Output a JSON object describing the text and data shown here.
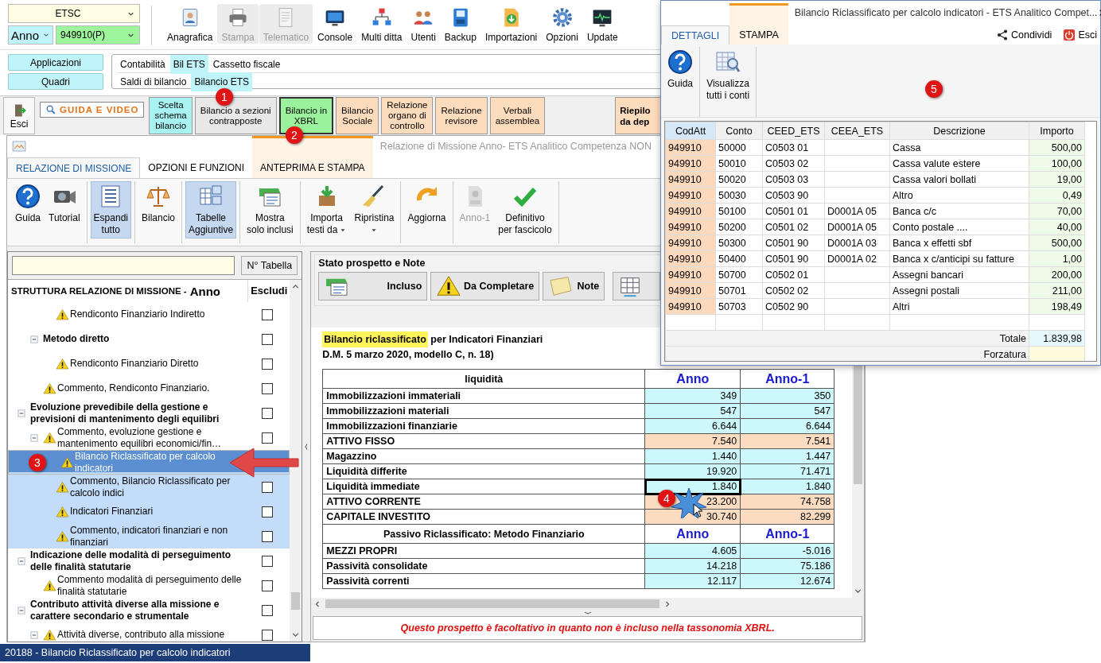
{
  "top_bar": {
    "company": {
      "value": "ETSC"
    },
    "year": {
      "value": "Anno"
    },
    "code": {
      "value": "949910(P)"
    },
    "buttons": [
      {
        "label": "Anagrafica",
        "disabled": false
      },
      {
        "label": "Stampa",
        "disabled": true
      },
      {
        "label": "Telematico",
        "disabled": true
      },
      {
        "label": "Console",
        "disabled": false
      },
      {
        "label": "Multi ditta",
        "disabled": false
      },
      {
        "label": "Utenti",
        "disabled": false
      },
      {
        "label": "Backup",
        "disabled": false
      },
      {
        "label": "Importazioni",
        "disabled": false
      },
      {
        "label": "Opzioni",
        "disabled": false
      },
      {
        "label": "Update",
        "disabled": false
      }
    ]
  },
  "navigation": {
    "side_buttons": [
      "Applicazioni",
      "Quadri"
    ],
    "rows": [
      {
        "items": [
          {
            "label": "Contabilità",
            "selected": false
          },
          {
            "label": "Bil ETS",
            "selected": true
          },
          {
            "label": "Cassetto fiscale",
            "selected": false
          }
        ]
      },
      {
        "items": [
          {
            "label": "Saldi di bilancio",
            "selected": false
          },
          {
            "label": "Bilancio ETS",
            "selected": true
          }
        ]
      }
    ]
  },
  "module_bar": {
    "exit_label": "Esci",
    "guide_label": "GUIDA E VIDEO",
    "modules": [
      {
        "label": "Scelta\nschema\nbilancio",
        "color": "#a8f2f2",
        "selected": false
      },
      {
        "label": "Bilancio a sezioni\ncontrapposte",
        "color": "#e8e8e8",
        "selected": false
      },
      {
        "label": "Bilancio in\nXBRL",
        "color": "#9cf29c",
        "selected": true
      },
      {
        "label": "Bilancio\nSociale",
        "color": "#fcdcbc",
        "selected": false
      },
      {
        "label": "Relazione\norgano di\ncontrollo",
        "color": "#fcdcbc",
        "selected": false
      },
      {
        "label": "Relazione\nrevisore",
        "color": "#fcdcbc",
        "selected": false
      },
      {
        "label": "Verbali\nassemblea",
        "color": "#fcdcbc",
        "selected": false
      }
    ],
    "summary_button": {
      "label": "Riepilo\nda dep"
    }
  },
  "window": {
    "title": "Relazione di Missione Anno- ETS Analitico Competenza NON",
    "tabs": [
      {
        "label": "RELAZIONE DI MISSIONE",
        "selected": true,
        "contextual": false
      },
      {
        "label": "OPZIONI E FUNZIONI",
        "selected": false,
        "contextual": false
      },
      {
        "label": "ANTEPRIMA E STAMPA",
        "selected": false,
        "contextual": true
      }
    ],
    "ribbon": [
      {
        "buttons": [
          {
            "label": "Guida",
            "on": false,
            "disabled": false,
            "dropdown": false
          },
          {
            "label": "Tutorial",
            "on": false,
            "disabled": false,
            "dropdown": false
          }
        ]
      },
      {
        "buttons": [
          {
            "label": "Espandi\ntutto",
            "on": true,
            "disabled": false,
            "dropdown": false
          }
        ]
      },
      {
        "buttons": [
          {
            "label": "Bilancio",
            "on": false,
            "disabled": false,
            "dropdown": false
          }
        ]
      },
      {
        "buttons": [
          {
            "label": "Tabelle\nAggiuntive",
            "on": true,
            "disabled": false,
            "dropdown": false
          }
        ]
      },
      {
        "buttons": [
          {
            "label": "Mostra\nsolo inclusi",
            "on": false,
            "disabled": false,
            "dropdown": false
          }
        ]
      },
      {
        "buttons": [
          {
            "label": "Importa\ntesti da",
            "on": false,
            "disabled": false,
            "dropdown": true
          },
          {
            "label": "Ripristina",
            "on": false,
            "disabled": false,
            "dropdown": true
          }
        ]
      },
      {
        "buttons": [
          {
            "label": "Aggiorna",
            "on": false,
            "disabled": false,
            "dropdown": false
          }
        ]
      },
      {
        "buttons": [
          {
            "label": "Anno-1",
            "on": false,
            "disabled": true,
            "dropdown": false
          },
          {
            "label": "Definitivo\nper fascicolo",
            "on": false,
            "disabled": false,
            "dropdown": false
          }
        ]
      }
    ]
  },
  "structure_panel": {
    "table_button": "N° Tabella",
    "title": "STRUTTURA RELAZIONE DI MISSIONE -",
    "title_year": "Anno",
    "exclude_header": "Escludi",
    "tree": [
      {
        "children": [
          {
            "children": [
              {
                "label": "Rendiconto Finanziario Indiretto",
                "kind": "comment",
                "excluded": false,
                "selected": false,
                "highlighted": false
              }
            ]
          },
          {
            "label": "Metodo diretto",
            "kind": "section",
            "expanded": true,
            "excluded": false,
            "selected": false,
            "highlighted": false,
            "children": [
              {
                "label": "Rendiconto Finanziario Diretto",
                "kind": "comment",
                "excluded": false,
                "selected": false,
                "highlighted": false
              }
            ]
          },
          {
            "label": "Commento, Rendiconto Finanziario.",
            "kind": "comment",
            "excluded": false,
            "selected": false,
            "highlighted": false
          }
        ]
      },
      {
        "label": "Evoluzione prevedibile della gestione e previsioni di mantenimento degli equilibri",
        "kind": "section",
        "expanded": true,
        "excluded": false,
        "selected": false,
        "highlighted": false,
        "children": [
          {
            "label": "Commento, evoluzione gestione e mantenimento equilibri economici/fin…",
            "kind": "comment",
            "expanded": true,
            "excluded": false,
            "selected": false,
            "highlighted": false,
            "children": [
              {
                "label": "Bilancio Riclassificato per calcolo indicatori",
                "kind": "comment",
                "selected": true,
                "highlighted": true
              },
              {
                "label": "Commento, Bilancio Riclassificato per calcolo indici",
                "kind": "comment",
                "excluded": false,
                "selected": false,
                "highlighted": true
              },
              {
                "label": "Indicatori Finanziari",
                "kind": "comment",
                "excluded": false,
                "selected": false,
                "highlighted": true
              },
              {
                "label": "Commento, indicatori finanziari e non finanziari",
                "kind": "comment",
                "excluded": false,
                "selected": false,
                "highlighted": true
              }
            ]
          }
        ]
      },
      {
        "label": "Indicazione delle modalità di perseguimento delle finalità statutarie",
        "kind": "section",
        "expanded": true,
        "excluded": false,
        "selected": false,
        "highlighted": false,
        "children": [
          {
            "label": "Commento modalità di perseguimento delle finalità statutarie",
            "kind": "comment",
            "excluded": false,
            "selected": false,
            "highlighted": false
          }
        ]
      },
      {
        "label": "Contributo attività diverse alla missione e carattere secondario e strumentale",
        "kind": "section",
        "expanded": true,
        "excluded": false,
        "selected": false,
        "highlighted": false,
        "children": [
          {
            "label": "Attività diverse, contributo alla missione",
            "kind": "comment",
            "expanded": true,
            "excluded": false,
            "selected": false,
            "highlighted": false
          }
        ]
      }
    ]
  },
  "status_panel": {
    "title": "Stato prospetto e Note",
    "buttons": [
      "Incluso",
      "Da Completare",
      "Note"
    ]
  },
  "document": {
    "heading_highlight": "Bilancio riclassificato",
    "heading_rest": "per Indicatori Finanziari",
    "subheading": "D.M. 5 marzo 2020, modello C, n. 18)",
    "rows": [
      {
        "kind": "header",
        "label": "liquidità",
        "values": [
          "Anno",
          "Anno-1"
        ],
        "selected": false
      },
      {
        "kind": "item",
        "label": "Immobilizzazioni immateriali",
        "values": [
          "349",
          "350"
        ],
        "selected": false
      },
      {
        "kind": "item",
        "label": "Immobilizzazioni materiali",
        "values": [
          "547",
          "547"
        ],
        "selected": false
      },
      {
        "kind": "item",
        "label": "Immobilizzazioni finanziarie",
        "values": [
          "6.644",
          "6.644"
        ],
        "selected": false
      },
      {
        "kind": "total",
        "label": "ATTIVO FISSO",
        "values": [
          "7.540",
          "7.541"
        ],
        "selected": false
      },
      {
        "kind": "item",
        "label": "Magazzino",
        "values": [
          "1.440",
          "1.447"
        ],
        "selected": false
      },
      {
        "kind": "item",
        "label": "Liquidità differite",
        "values": [
          "19.920",
          "71.471"
        ],
        "selected": false
      },
      {
        "kind": "item",
        "label": "Liquidità immediate",
        "values": [
          "1.840",
          "1.840"
        ],
        "selected": true
      },
      {
        "kind": "total",
        "label": "ATTIVO CORRENTE",
        "values": [
          "23.200",
          "74.758"
        ],
        "selected": false
      },
      {
        "kind": "total",
        "label": "CAPITALE INVESTITO",
        "values": [
          "30.740",
          "82.299"
        ],
        "selected": false
      },
      {
        "kind": "header",
        "label": "Passivo Riclassificato: Metodo Finanziario",
        "values": [
          "Anno",
          "Anno-1"
        ],
        "selected": false
      },
      {
        "kind": "item",
        "label": "MEZZI PROPRI",
        "values": [
          "4.605",
          "-5.016"
        ],
        "selected": false
      },
      {
        "kind": "item",
        "label": "Passività consolidate",
        "values": [
          "14.218",
          "75.186"
        ],
        "selected": false
      },
      {
        "kind": "item",
        "label": "Passività correnti",
        "values": [
          "12.117",
          "12.674"
        ],
        "selected": false
      }
    ]
  },
  "message": "Questo prospetto è facoltativo in quanto non è incluso nella tassonomia XBRL.",
  "status_bar": "20188 - Bilancio Riclassificato per calcolo indicatori",
  "popup": {
    "title": "Bilancio Riclassificato per calcolo indicatori - ETS Analitico Compet...",
    "tabs": [
      {
        "label": "DETTAGLI",
        "selected": true,
        "contextual": false
      },
      {
        "label": "STAMPA",
        "selected": false,
        "contextual": true
      }
    ],
    "actions": [
      "Condividi",
      "Esci"
    ],
    "ribbon": [
      "Guida",
      "Visualizza\ntutti i conti"
    ],
    "columns": [
      {
        "label": "CodAtt",
        "selected": true
      },
      {
        "label": "Conto",
        "selected": false
      },
      {
        "label": "CEED_ETS",
        "selected": false
      },
      {
        "label": "CEEA_ETS",
        "selected": false
      },
      {
        "label": "Descrizione",
        "selected": false
      },
      {
        "label": "Importo",
        "selected": false
      }
    ],
    "rows": [
      {
        "cod_att": "949910",
        "conto": "50000",
        "ceed_ets": "C0503 01",
        "descrizione": "Cassa",
        "importo": "500,00"
      },
      {
        "cod_att": "949910",
        "conto": "50010",
        "ceed_ets": "C0503 02",
        "descrizione": "Cassa valute estere",
        "importo": "100,00"
      },
      {
        "cod_att": "949910",
        "conto": "50020",
        "ceed_ets": "C0503 03",
        "descrizione": "Cassa valori bollati",
        "importo": "19,00"
      },
      {
        "cod_att": "949910",
        "conto": "50030",
        "ceed_ets": "C0503 90",
        "descrizione": "Altro",
        "importo": "0,49"
      },
      {
        "cod_att": "949910",
        "conto": "50100",
        "ceed_ets": "C0501 01",
        "ceea_ets": "D0001A 05",
        "descrizione": "Banca c/c",
        "importo": "70,00"
      },
      {
        "cod_att": "949910",
        "conto": "50200",
        "ceed_ets": "C0501 02",
        "ceea_ets": "D0001A 05",
        "descrizione": "Conto postale ....",
        "importo": "40,00"
      },
      {
        "cod_att": "949910",
        "conto": "50300",
        "ceed_ets": "C0501 90",
        "ceea_ets": "D0001A 03",
        "descrizione": "Banca x effetti sbf",
        "importo": "500,00"
      },
      {
        "cod_att": "949910",
        "conto": "50400",
        "ceed_ets": "C0501 90",
        "ceea_ets": "D0001A 02",
        "descrizione": "Banca x c/anticipi su fatture",
        "importo": "1,00"
      },
      {
        "cod_att": "949910",
        "conto": "50700",
        "ceed_ets": "C0502 01",
        "descrizione": "Assegni bancari",
        "importo": "200,00"
      },
      {
        "cod_att": "949910",
        "conto": "50701",
        "ceed_ets": "C0502 02",
        "descrizione": "Assegni postali",
        "importo": "211,00"
      },
      {
        "cod_att": "949910",
        "conto": "50703",
        "ceed_ets": "C0502 90",
        "descrizione": "Altri",
        "importo": "198,49"
      }
    ],
    "total_label": "Totale",
    "total_value": "1.839,98",
    "override_label": "Forzatura"
  },
  "annotations": [
    "1",
    "2",
    "3",
    "4",
    "5"
  ]
}
